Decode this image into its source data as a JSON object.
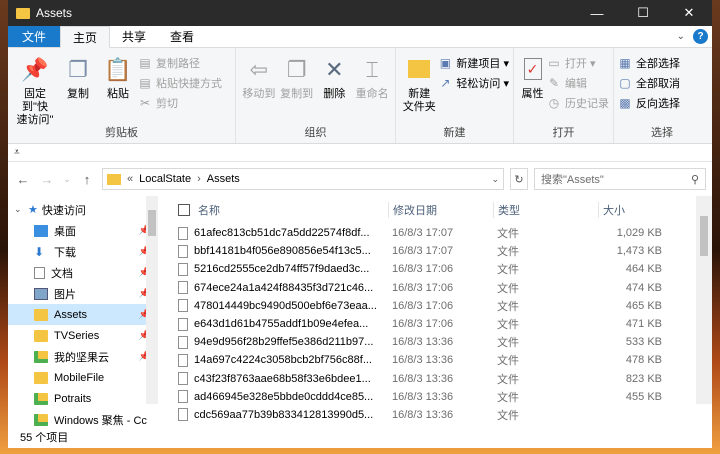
{
  "window": {
    "title": "Assets"
  },
  "titlebar_buttons": [
    "—",
    "☐",
    "✕"
  ],
  "ribbon_tabs": [
    {
      "label": "文件",
      "kind": "file"
    },
    {
      "label": "主页",
      "kind": "active"
    },
    {
      "label": "共享",
      "kind": "normal"
    },
    {
      "label": "查看",
      "kind": "normal"
    }
  ],
  "ribbon": {
    "clipboard": {
      "label": "剪贴板",
      "pin": "固定到\"快\n速访问\"",
      "copy": "复制",
      "paste": "粘贴",
      "copy_path": "复制路径",
      "paste_shortcut": "粘贴快捷方式",
      "cut": "剪切"
    },
    "organize": {
      "label": "组织",
      "move_to": "移动到",
      "copy_to": "复制到",
      "delete": "删除",
      "rename": "重命名"
    },
    "new": {
      "label": "新建",
      "new_folder": "新建\n文件夹",
      "new_item": "新建项目 ▾",
      "easy_access": "轻松访问 ▾"
    },
    "open": {
      "label": "打开",
      "properties": "属性",
      "open": "打开 ▾",
      "edit": "编辑",
      "history": "历史记录"
    },
    "select": {
      "label": "选择",
      "select_all": "全部选择",
      "select_none": "全部取消",
      "invert": "反向选择"
    }
  },
  "address": {
    "prefix": "«",
    "crumb1": "LocalState",
    "sep": "›",
    "crumb2": "Assets"
  },
  "search": {
    "placeholder": "搜索\"Assets\""
  },
  "sidebar": {
    "items": [
      {
        "label": "快速访问",
        "root": true,
        "pinned": false
      },
      {
        "label": "桌面",
        "pinned": true
      },
      {
        "label": "下载",
        "pinned": true
      },
      {
        "label": "文档",
        "pinned": true
      },
      {
        "label": "图片",
        "pinned": true
      },
      {
        "label": "Assets",
        "pinned": true,
        "selected": true
      },
      {
        "label": "TVSeries",
        "pinned": true
      },
      {
        "label": "我的坚果云",
        "pinned": true
      },
      {
        "label": "MobileFile",
        "pinned": false
      },
      {
        "label": "Potraits",
        "pinned": false
      },
      {
        "label": "Windows 聚焦 - Cc",
        "pinned": false
      }
    ]
  },
  "columns": {
    "name": "名称",
    "date": "修改日期",
    "type": "类型",
    "size": "大小"
  },
  "files": [
    {
      "name": "61afec813cb51dc7a5dd22574f8df...",
      "date": "16/8/3 17:07",
      "type": "文件",
      "size": "1,029 KB"
    },
    {
      "name": "bbf14181b4f056e890856e54f13c5...",
      "date": "16/8/3 17:07",
      "type": "文件",
      "size": "1,473 KB"
    },
    {
      "name": "5216cd2555ce2db74ff57f9daed3c...",
      "date": "16/8/3 17:06",
      "type": "文件",
      "size": "464 KB"
    },
    {
      "name": "674ece24a1a424f88435f3d721c46...",
      "date": "16/8/3 17:06",
      "type": "文件",
      "size": "474 KB"
    },
    {
      "name": "478014449bc9490d500ebf6e73eaa...",
      "date": "16/8/3 17:06",
      "type": "文件",
      "size": "465 KB"
    },
    {
      "name": "e643d1d61b4755addf1b09e4efea...",
      "date": "16/8/3 17:06",
      "type": "文件",
      "size": "471 KB"
    },
    {
      "name": "94e9d956f28b29ffef5e386d211b97...",
      "date": "16/8/3 13:36",
      "type": "文件",
      "size": "533 KB"
    },
    {
      "name": "14a697c4224c3058bcb2bf756c88f...",
      "date": "16/8/3 13:36",
      "type": "文件",
      "size": "478 KB"
    },
    {
      "name": "c43f23f8763aae68b58f33e6bdee1...",
      "date": "16/8/3 13:36",
      "type": "文件",
      "size": "823 KB"
    },
    {
      "name": "ad466945e328e5bbde0cddd4ce85...",
      "date": "16/8/3 13:36",
      "type": "文件",
      "size": "455 KB"
    },
    {
      "name": "cdc569aa77b39b833412813990d5...",
      "date": "16/8/3 13:36",
      "type": "文件",
      "size": ""
    }
  ],
  "status": {
    "count": "55 个项目"
  },
  "watermark": {
    "text": "亿速云"
  }
}
